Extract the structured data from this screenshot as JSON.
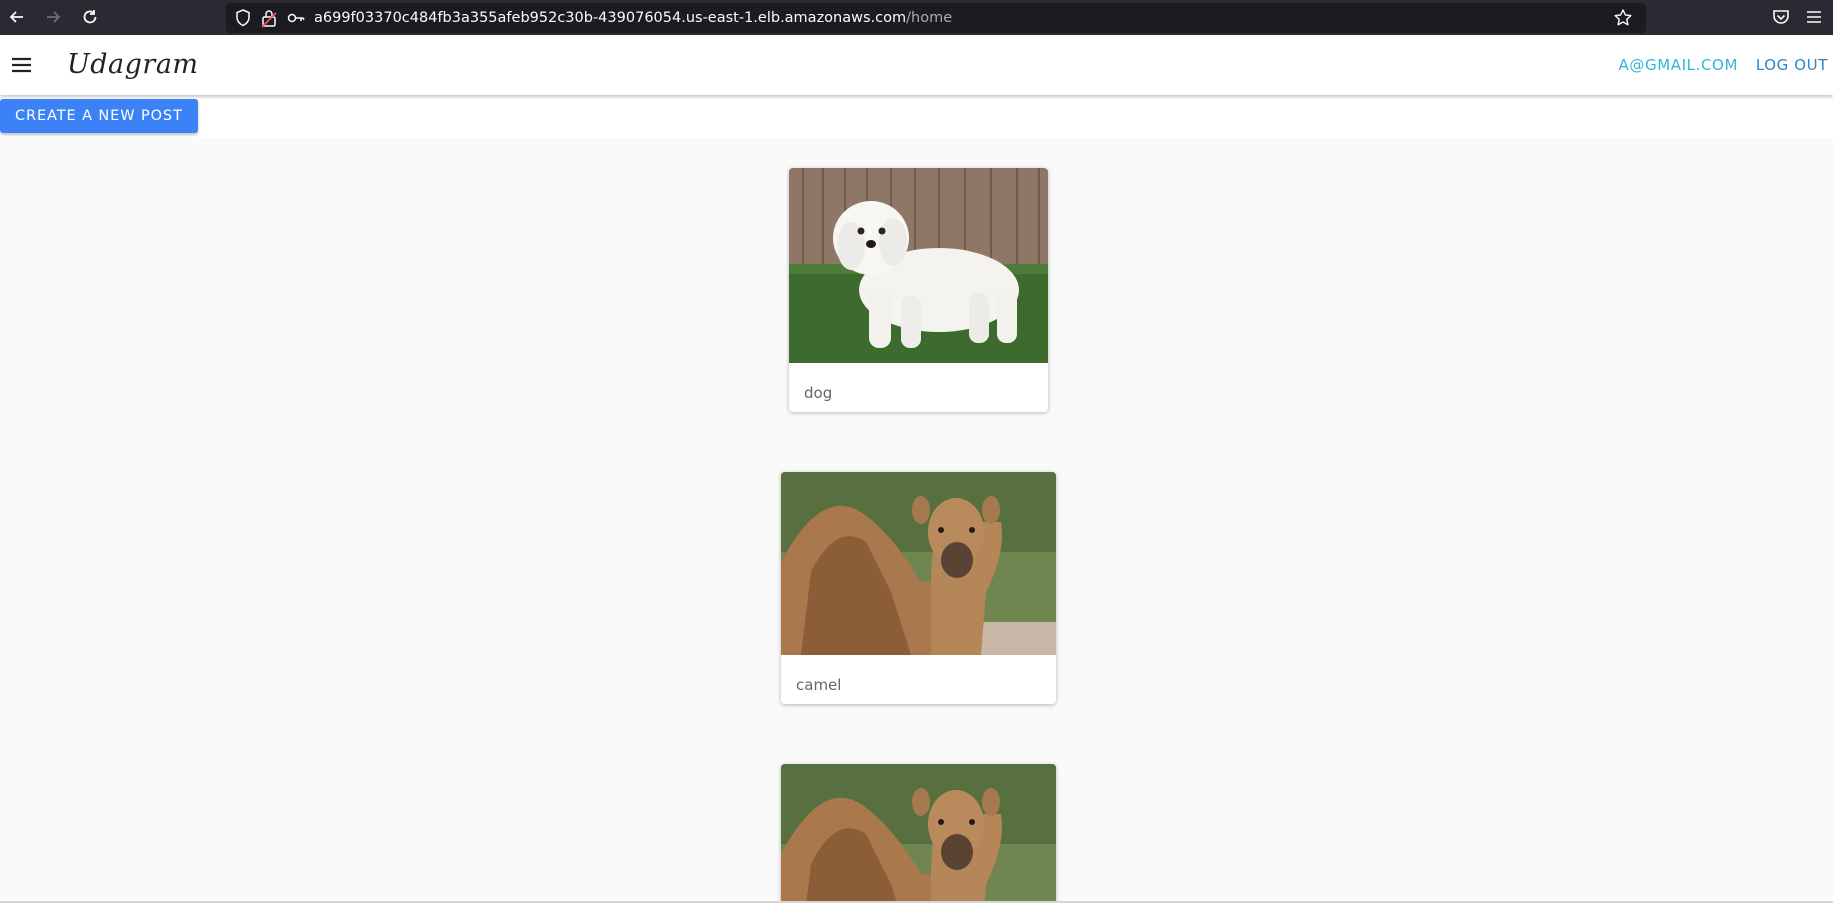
{
  "browser": {
    "url_host": "a699f03370c484fb3a355afeb952c30b-439076054.us-east-1.elb.amazonaws.com",
    "url_path": "/home",
    "icons": [
      "back-arrow-icon",
      "forward-arrow-icon",
      "reload-icon",
      "shield-icon",
      "lock-icon",
      "key-icon",
      "bookmark-star-icon",
      "pocket-icon",
      "hamburger-menu-icon"
    ]
  },
  "header": {
    "brand": "Udagram",
    "user_email": "A@GMAIL.COM",
    "logout_label": "LOG OUT"
  },
  "toolbar": {
    "create_post_label": "CREATE A NEW POST"
  },
  "feed": {
    "posts": [
      {
        "caption": "dog",
        "image": "white-fluffy-puppy-on-grass"
      },
      {
        "caption": "camel",
        "image": "camel-portrait"
      },
      {
        "caption": "",
        "image": "camel-portrait"
      }
    ]
  },
  "colors": {
    "primary_button": "#3b82f6",
    "email_link": "#31b6d8",
    "logout_link": "#2b87c8",
    "page_bg": "#fafafa"
  }
}
